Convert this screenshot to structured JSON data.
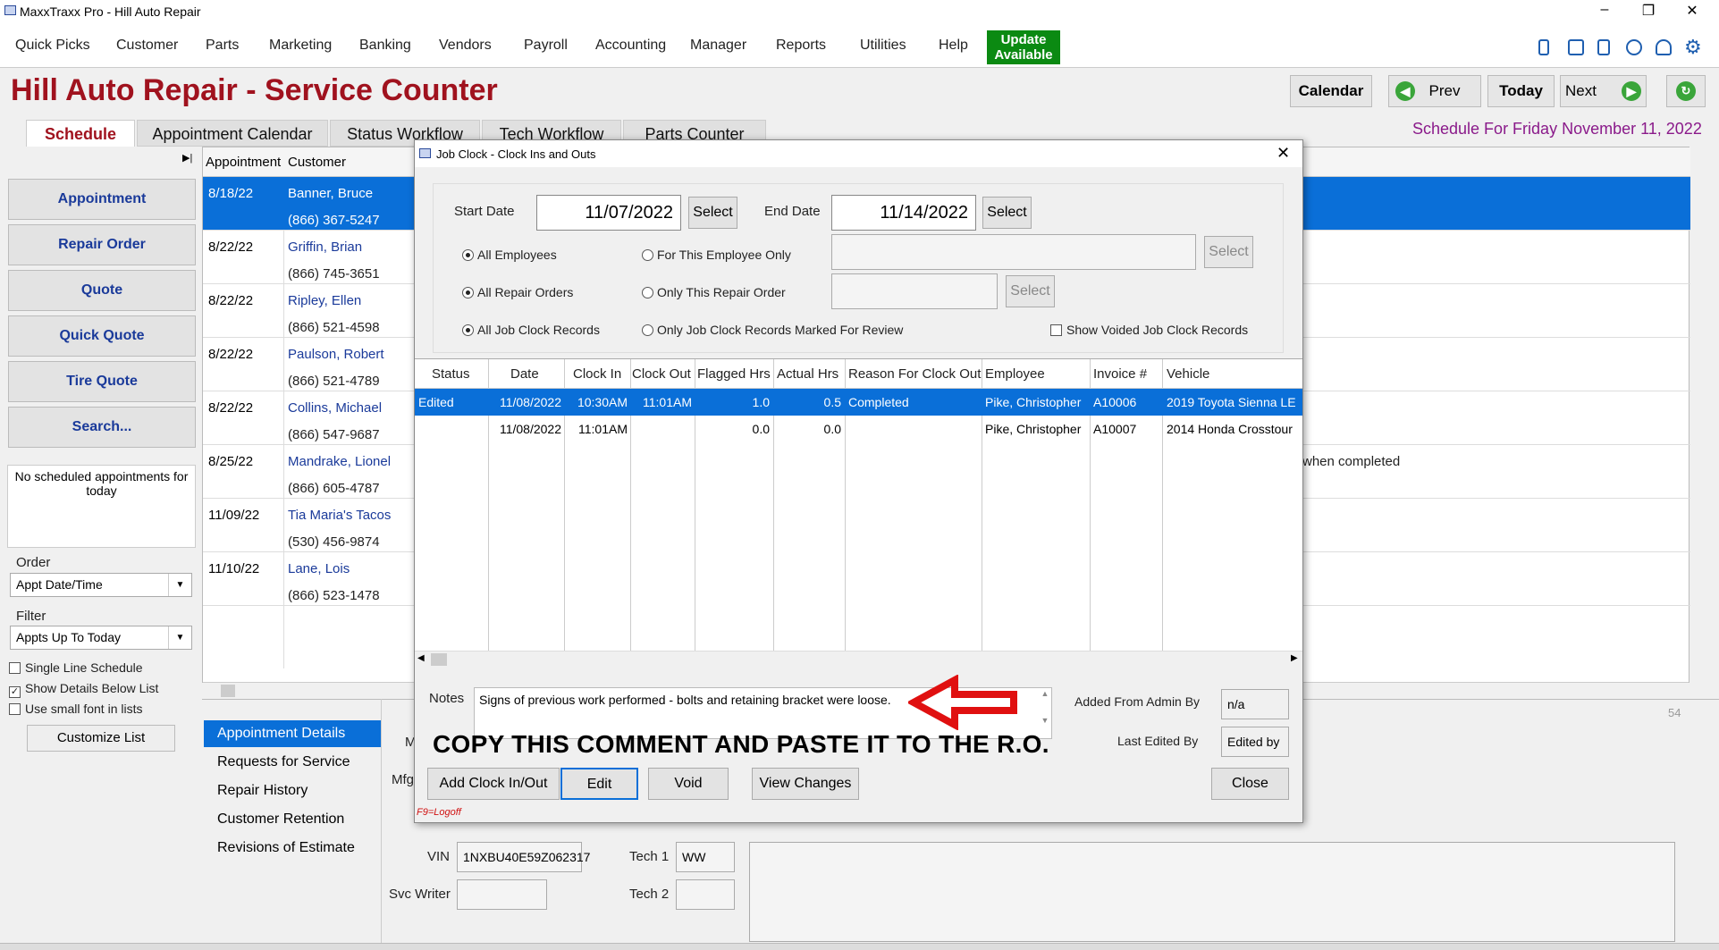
{
  "window": {
    "title": "MaxxTraxx Pro - Hill Auto Repair",
    "controls": [
      "–",
      "❐",
      "✕"
    ]
  },
  "menu": [
    "Quick Picks",
    "Customer",
    "Parts",
    "Marketing",
    "Banking",
    "Vendors",
    "Payroll",
    "Accounting",
    "Manager",
    "Reports",
    "Utilities",
    "Help"
  ],
  "update": {
    "line1": "Update",
    "line2": "Available"
  },
  "header": {
    "title": "Hill Auto Repair - Service Counter",
    "calendar": "Calendar",
    "prev": "Prev",
    "today": "Today",
    "next": "Next",
    "schedule_date": "Schedule For Friday November 11, 2022"
  },
  "tabs": [
    "Schedule",
    "Appointment Calendar",
    "Status Workflow",
    "Tech Workflow",
    "Parts Counter"
  ],
  "left": {
    "buttons": [
      "Appointment",
      "Repair Order",
      "Quote",
      "Quick Quote",
      "Tire Quote",
      "Search..."
    ],
    "no_appts": "No scheduled appointments for today",
    "order_label": "Order",
    "order_value": "Appt Date/Time",
    "filter_label": "Filter",
    "filter_value": "Appts Up To Today",
    "checks": [
      {
        "label": "Single Line Schedule",
        "checked": false
      },
      {
        "label": "Show Details Below List",
        "checked": true
      },
      {
        "label": "Use small font in lists",
        "checked": false
      }
    ],
    "customize": "Customize List"
  },
  "grid": {
    "headers": [
      "Appointment",
      "Customer"
    ],
    "rows": [
      {
        "date": "8/18/22",
        "name": "Banner, Bruce",
        "phone": "(866) 367-5247"
      },
      {
        "date": "8/22/22",
        "name": "Griffin, Brian",
        "phone": "(866) 745-3651"
      },
      {
        "date": "8/22/22",
        "name": "Ripley, Ellen",
        "phone": "(866) 521-4598"
      },
      {
        "date": "8/22/22",
        "name": "Paulson, Robert",
        "phone": "(866) 521-4789"
      },
      {
        "date": "8/22/22",
        "name": "Collins, Michael",
        "phone": "(866) 547-9687"
      },
      {
        "date": "8/25/22",
        "name": "Mandrake, Lionel",
        "phone": "(866) 605-4787"
      },
      {
        "date": "11/09/22",
        "name": "Tia Maria's Tacos",
        "phone": "(530) 456-9874"
      },
      {
        "date": "11/10/22",
        "name": "Lane, Lois",
        "phone": "(866) 523-1478"
      }
    ],
    "note_fragment": "when completed",
    "count": "54"
  },
  "details": {
    "tabs": [
      "Appointment Details",
      "Requests for Service",
      "Repair History",
      "Customer Retention",
      "Revisions of Estimate"
    ],
    "vin_label": "VIN",
    "vin": "1NXBU40E59Z062317",
    "svc_label": "Svc Writer",
    "tech1_label": "Tech 1",
    "tech1": "WW",
    "tech2_label": "Tech 2",
    "mfg_label": "Mfg",
    "m_label": "M"
  },
  "dialog": {
    "title": "Job Clock - Clock Ins and Outs",
    "start_label": "Start Date",
    "start": "11/07/2022",
    "end_label": "End Date",
    "end": "11/14/2022",
    "select": "Select",
    "radios": {
      "all_emp": "All Employees",
      "this_emp": "For This Employee Only",
      "all_ro": "All Repair Orders",
      "this_ro": "Only This Repair Order",
      "all_jc": "All Job Clock Records",
      "review": "Only Job Clock Records Marked For Review",
      "voided": "Show Voided Job Clock Records"
    },
    "columns": [
      "Status",
      "Date",
      "Clock In",
      "Clock Out",
      "Flagged Hrs",
      "Actual Hrs",
      "Reason For Clock Out",
      "Employee",
      "Invoice #",
      "Vehicle"
    ],
    "rows": [
      {
        "status": "Edited",
        "date": "11/08/2022",
        "in": "10:30AM",
        "out": "11:01AM",
        "flagged": "1.0",
        "actual": "0.5",
        "reason": "Completed",
        "employee": "Pike, Christopher",
        "invoice": "A10006",
        "vehicle": "2019 Toyota Sienna LE"
      },
      {
        "status": "",
        "date": "11/08/2022",
        "in": "11:01AM",
        "out": "",
        "flagged": "0.0",
        "actual": "0.0",
        "reason": "",
        "employee": "Pike, Christopher",
        "invoice": "A10007",
        "vehicle": "2014 Honda Crosstour"
      }
    ],
    "notes_label": "Notes",
    "notes": "Signs of previous work performed - bolts and retaining bracket were loose.",
    "added_label": "Added From Admin By",
    "added": "n/a",
    "edited_label": "Last Edited By",
    "edited": "Edited by",
    "annotation": "COPY THIS COMMENT AND PASTE IT TO THE R.O.",
    "buttons": {
      "add": "Add Clock In/Out",
      "edit": "Edit",
      "void": "Void",
      "view": "View Changes",
      "close": "Close"
    },
    "logoff": "F9=Logoff"
  },
  "colors": {
    "accent": "#0a6fd8",
    "brand": "#a0121e",
    "update": "#0b8a12",
    "arrow": "#e01010"
  }
}
